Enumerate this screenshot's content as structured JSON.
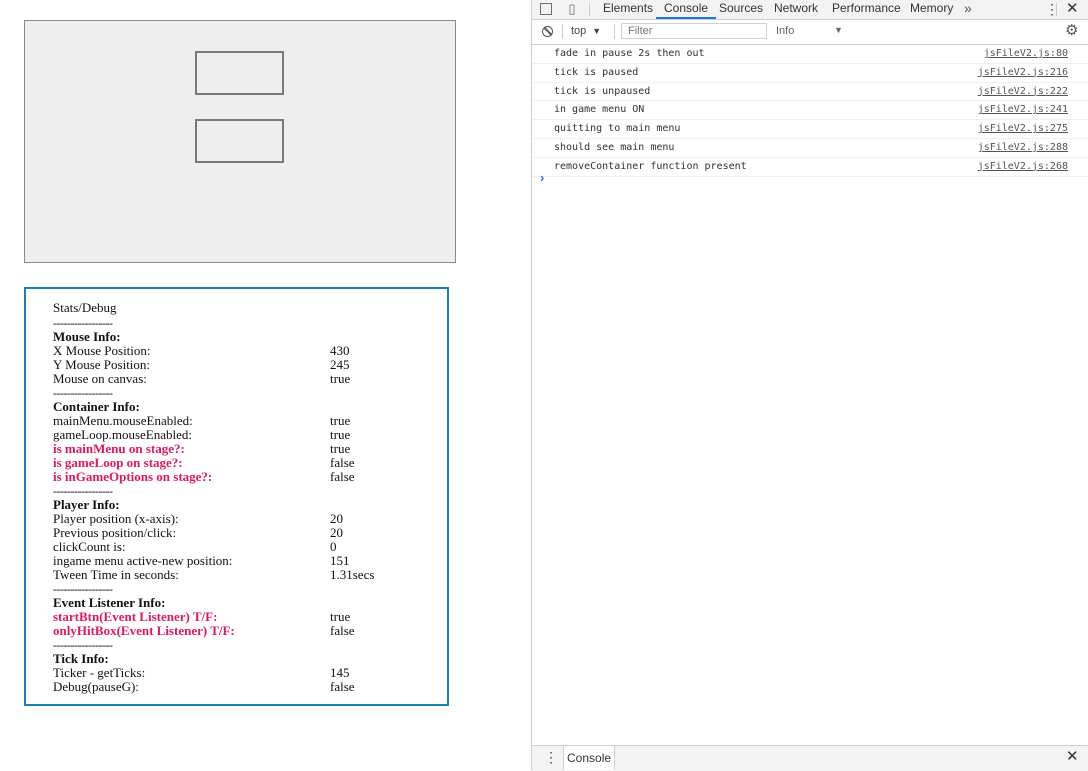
{
  "stats": {
    "title": "Stats/Debug",
    "separator": "-----------------",
    "mouse": {
      "header": "Mouse Info:",
      "rows": [
        {
          "label": "X Mouse Position:",
          "value": "430"
        },
        {
          "label": "Y Mouse Position:",
          "value": "245"
        },
        {
          "label": "Mouse on canvas:",
          "value": "true"
        }
      ]
    },
    "container": {
      "header": "Container Info:",
      "rows": [
        {
          "label": "mainMenu.mouseEnabled:",
          "value": "true"
        },
        {
          "label": "gameLoop.mouseEnabled:",
          "value": "true"
        },
        {
          "label": "is mainMenu on stage?:",
          "value": "true"
        },
        {
          "label": "is gameLoop on stage?:",
          "value": "false"
        },
        {
          "label": "is inGameOptions on stage?:",
          "value": "false"
        }
      ]
    },
    "player": {
      "header": "Player Info:",
      "rows": [
        {
          "label": "Player position (x-axis):",
          "value": "20"
        },
        {
          "label": "Previous position/click:",
          "value": "20"
        },
        {
          "label": "clickCount is:",
          "value": "0"
        },
        {
          "label": "ingame menu active-new position:",
          "value": "151"
        },
        {
          "label": "Tween Time in seconds:",
          "value": "1.31secs"
        }
      ]
    },
    "events": {
      "header": "Event Listener Info:",
      "rows": [
        {
          "label": "startBtn(Event Listener) T/F:",
          "value": "true"
        },
        {
          "label": "onlyHitBox(Event Listener) T/F:",
          "value": "false"
        }
      ]
    },
    "tick": {
      "header": "Tick Info:",
      "rows": [
        {
          "label": "Ticker - getTicks:",
          "value": "145"
        },
        {
          "label": "Debug(pauseG):",
          "value": "false"
        }
      ]
    }
  },
  "devtools": {
    "tabs": [
      "Elements",
      "Console",
      "Sources",
      "Network",
      "Performance",
      "Memory"
    ],
    "active_tab": "Console",
    "more_tabs": "»",
    "context": "top",
    "filter_placeholder": "Filter",
    "level": "Info",
    "messages": [
      {
        "text": "fade in pause 2s then out",
        "source": "jsFileV2.js:80"
      },
      {
        "text": "tick is paused",
        "source": "jsFileV2.js:216"
      },
      {
        "text": "tick is unpaused",
        "source": "jsFileV2.js:222"
      },
      {
        "text": "in game menu ON",
        "source": "jsFileV2.js:241"
      },
      {
        "text": "quitting to main menu",
        "source": "jsFileV2.js:275"
      },
      {
        "text": "should see main menu",
        "source": "jsFileV2.js:288"
      },
      {
        "text": "removeContainer function present",
        "source": "jsFileV2.js:268"
      }
    ],
    "prompt": "›",
    "drawer_tab": "Console"
  },
  "icons": {
    "inspect": "inspect-element-icon",
    "device": "device-toolbar-icon",
    "kebab": "kebab-menu-icon",
    "close": "close-icon",
    "clear": "clear-console-icon",
    "gear": "settings-gear-icon"
  },
  "colors": {
    "highlight": "#e0185e",
    "stats_border": "#1a7fb5",
    "active_tab": "#1a73e8"
  }
}
